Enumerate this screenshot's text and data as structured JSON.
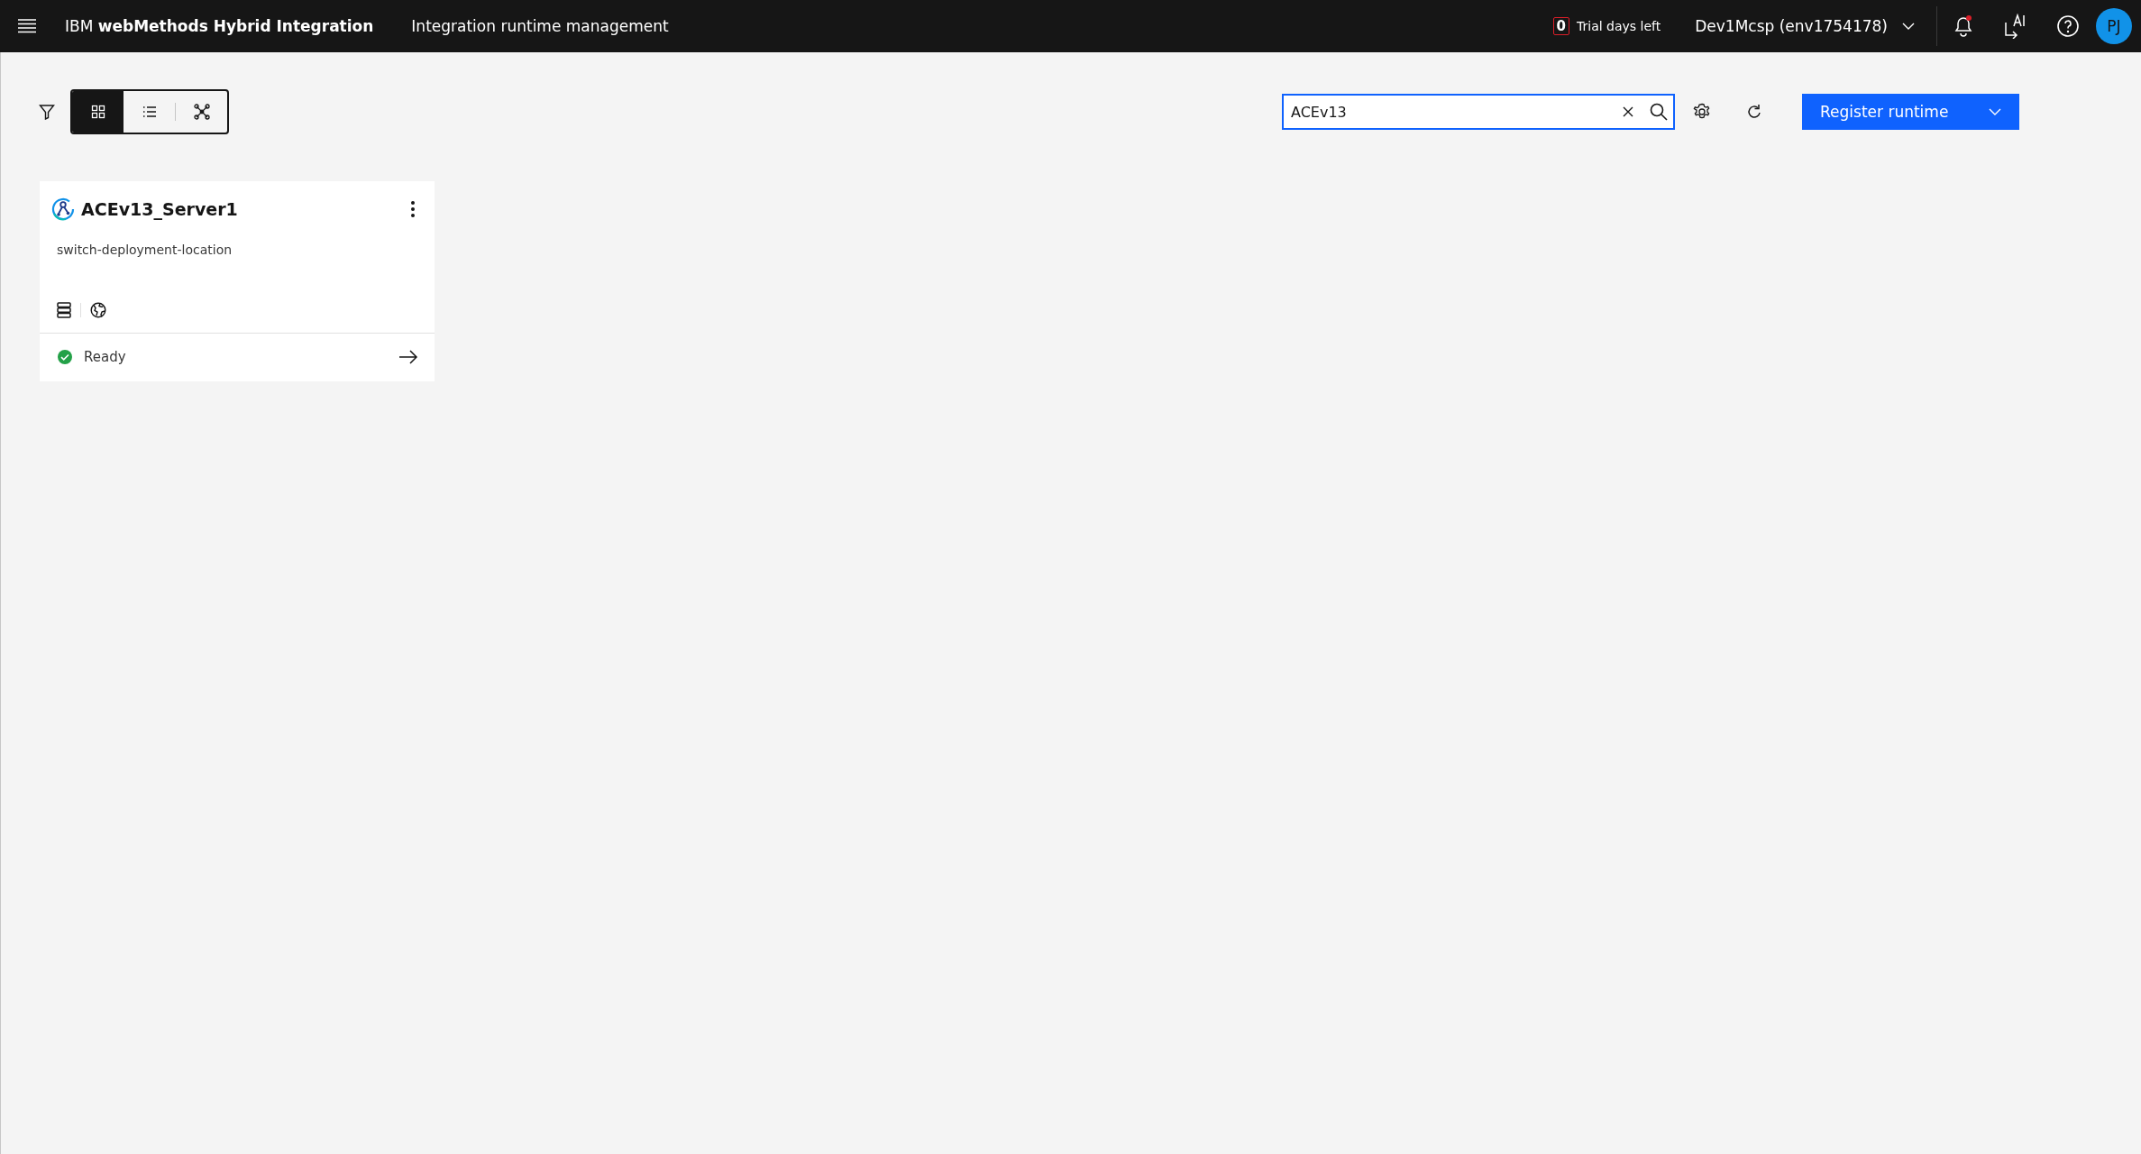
{
  "header": {
    "brand": "IBM **webMethods Hybrid Integration**",
    "page_title": "Integration runtime management",
    "trial": {
      "count": "0",
      "label": "Trial days left"
    },
    "environment": "Dev1Mcsp (env1754178)",
    "notifications_unread": true,
    "avatar": "PJ"
  },
  "toolbar": {
    "views": [
      {
        "kind": "grid",
        "selected": true
      },
      {
        "kind": "list",
        "selected": false
      },
      {
        "kind": "topology",
        "selected": false
      }
    ],
    "search": {
      "value": "ACEv13"
    },
    "primary_button": "Register runtime"
  },
  "cards": [
    {
      "title": "ACEv13_Server1",
      "description": "switch-deployment-location",
      "status": {
        "kind": "ready",
        "label": "Ready"
      }
    }
  ]
}
